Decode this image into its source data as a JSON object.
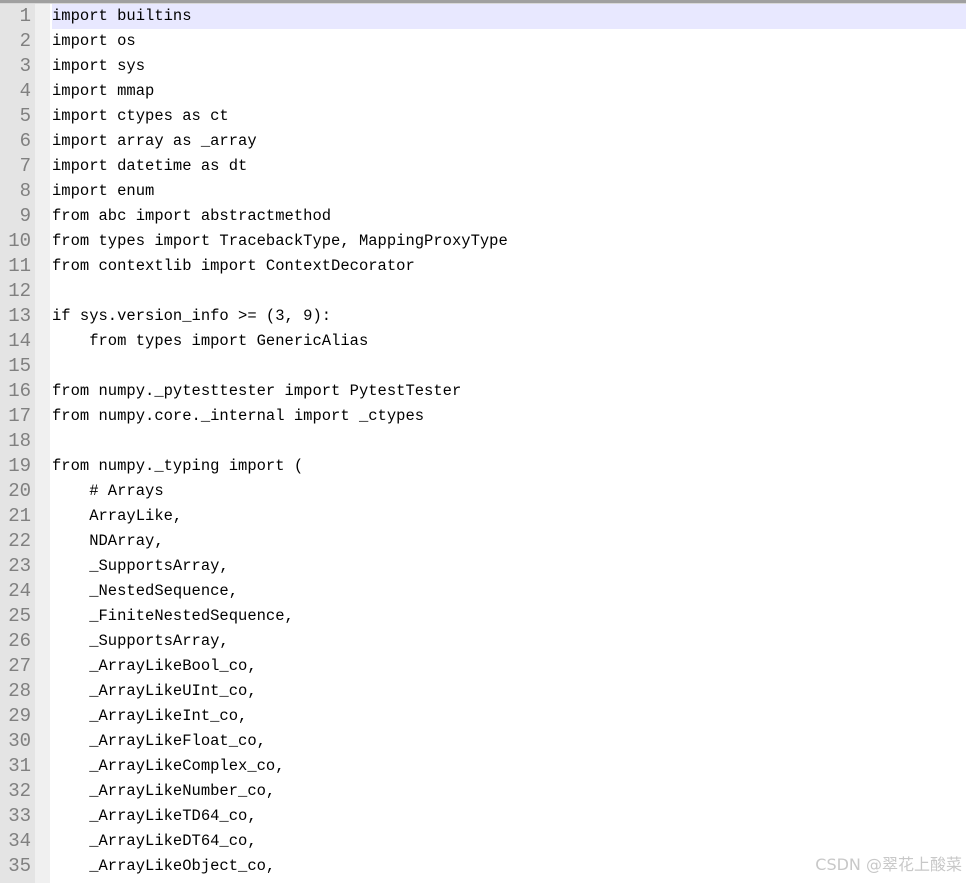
{
  "editor": {
    "current_line": 1,
    "lines": [
      "import builtins",
      "import os",
      "import sys",
      "import mmap",
      "import ctypes as ct",
      "import array as _array",
      "import datetime as dt",
      "import enum",
      "from abc import abstractmethod",
      "from types import TracebackType, MappingProxyType",
      "from contextlib import ContextDecorator",
      "",
      "if sys.version_info >= (3, 9):",
      "    from types import GenericAlias",
      "",
      "from numpy._pytesttester import PytestTester",
      "from numpy.core._internal import _ctypes",
      "",
      "from numpy._typing import (",
      "    # Arrays",
      "    ArrayLike,",
      "    NDArray,",
      "    _SupportsArray,",
      "    _NestedSequence,",
      "    _FiniteNestedSequence,",
      "    _SupportsArray,",
      "    _ArrayLikeBool_co,",
      "    _ArrayLikeUInt_co,",
      "    _ArrayLikeInt_co,",
      "    _ArrayLikeFloat_co,",
      "    _ArrayLikeComplex_co,",
      "    _ArrayLikeNumber_co,",
      "    _ArrayLikeTD64_co,",
      "    _ArrayLikeDT64_co,",
      "    _ArrayLikeObject_co,"
    ]
  },
  "watermark": "CSDN @翠花上酸菜"
}
